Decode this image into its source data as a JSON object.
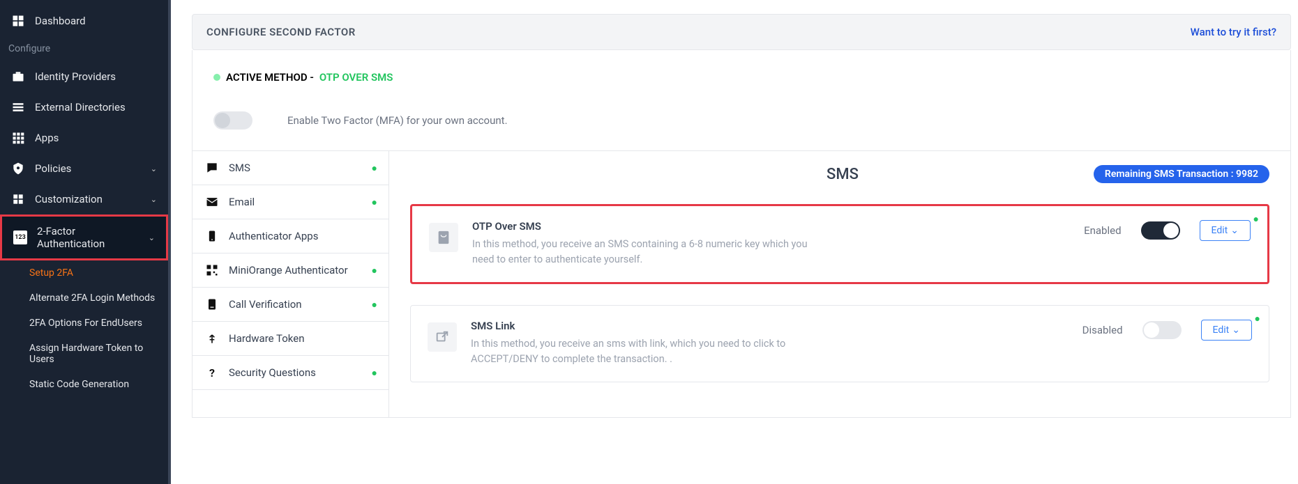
{
  "sidebar": {
    "items": [
      {
        "label": "Dashboard"
      },
      {
        "label": "Identity Providers"
      },
      {
        "label": "External Directories"
      },
      {
        "label": "Apps"
      },
      {
        "label": "Policies"
      },
      {
        "label": "Customization"
      },
      {
        "label": "2-Factor Authentication"
      }
    ],
    "configure_section": "Configure",
    "sub_items": [
      {
        "label": "Setup 2FA",
        "active": true
      },
      {
        "label": "Alternate 2FA Login Methods"
      },
      {
        "label": "2FA Options For EndUsers"
      },
      {
        "label": "Assign Hardware Token to Users"
      },
      {
        "label": "Static Code Generation"
      }
    ]
  },
  "header": {
    "title": "CONFIGURE SECOND FACTOR",
    "try_link": "Want to try it first?"
  },
  "active_method": {
    "label": "ACTIVE METHOD - ",
    "method": "OTP OVER SMS"
  },
  "enable_row": {
    "text": "Enable Two Factor (MFA) for your own account."
  },
  "tabs": [
    {
      "label": "SMS",
      "tick": true
    },
    {
      "label": "Email",
      "tick": true
    },
    {
      "label": "Authenticator Apps",
      "tick": false
    },
    {
      "label": "MiniOrange Authenticator",
      "tick": true
    },
    {
      "label": "Call Verification",
      "tick": true
    },
    {
      "label": "Hardware Token",
      "tick": false
    },
    {
      "label": "Security Questions",
      "tick": true
    }
  ],
  "methods_header": {
    "title": "SMS",
    "badge": "Remaining SMS Transaction : 9982"
  },
  "methods": [
    {
      "name": "OTP Over SMS",
      "desc": "In this method, you receive an SMS containing a 6-8 numeric key which you need to enter to authenticate yourself.",
      "state": "Enabled",
      "toggle": true,
      "edit": "Edit"
    },
    {
      "name": "SMS Link",
      "desc": "In this method, you receive an sms with link, which you need to click to ACCEPT/DENY to complete the transaction. .",
      "state": "Disabled",
      "toggle": false,
      "edit": "Edit"
    }
  ]
}
